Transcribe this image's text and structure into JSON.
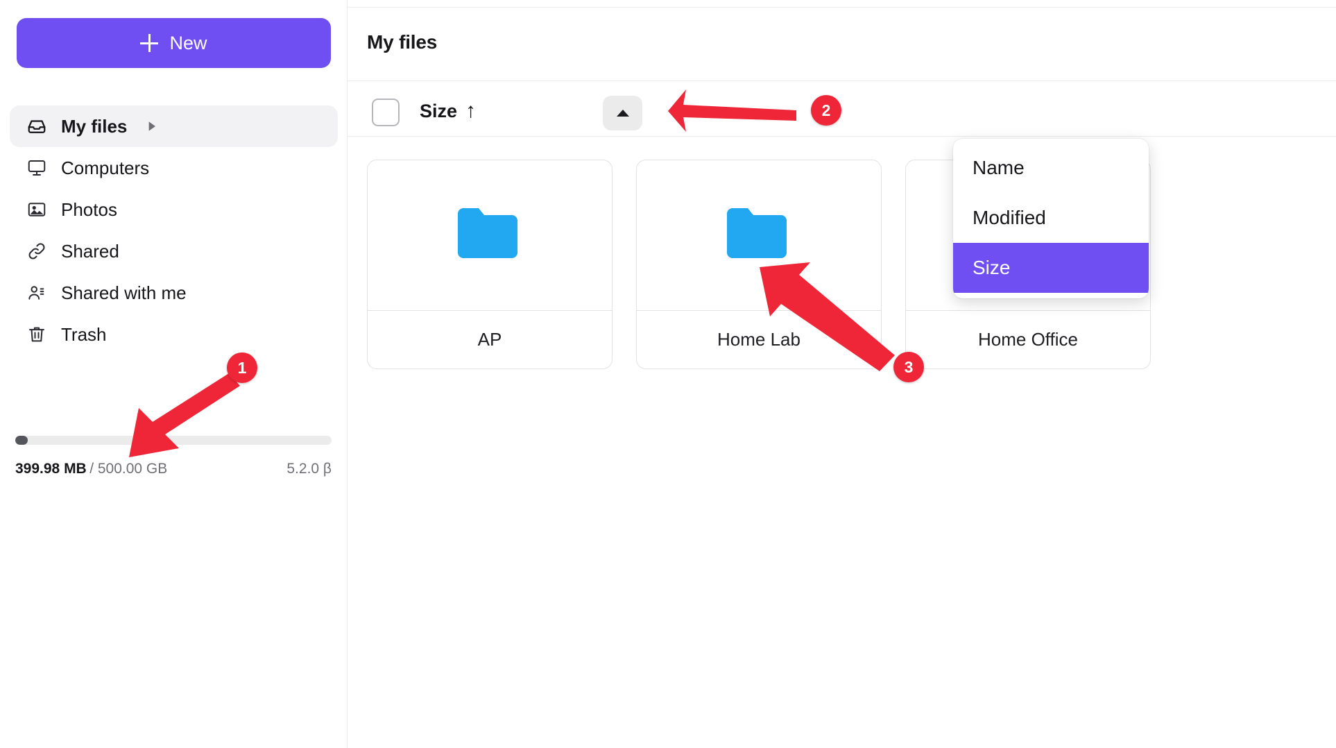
{
  "colors": {
    "accent_purple": "#6f4ef2",
    "folder_blue": "#22a8f0",
    "annotation_red": "#ee2637",
    "sidebar_active_bg": "#f2f2f4",
    "border": "#e2e2e5"
  },
  "sidebar": {
    "new_button": {
      "label": "New",
      "icon": "plus-icon"
    },
    "items": [
      {
        "label": "My files",
        "icon": "inbox-tray-icon",
        "active": true,
        "has_chevron": true
      },
      {
        "label": "Computers",
        "icon": "monitor-icon",
        "active": false,
        "has_chevron": false
      },
      {
        "label": "Photos",
        "icon": "image-icon",
        "active": false,
        "has_chevron": false
      },
      {
        "label": "Shared",
        "icon": "link-icon",
        "active": false,
        "has_chevron": false
      },
      {
        "label": "Shared with me",
        "icon": "users-icon",
        "active": false,
        "has_chevron": false
      },
      {
        "label": "Trash",
        "icon": "trash-icon",
        "active": false,
        "has_chevron": false
      }
    ],
    "storage": {
      "used": "399.98 MB",
      "separator_and_total": "/ 500.00 GB",
      "percent_filled": 4,
      "version": "5.2.0 β"
    }
  },
  "main": {
    "title": "My files",
    "toolbar": {
      "select_all_checked": false,
      "sort_field_label": "Size",
      "sort_direction_glyph": "↑",
      "sort_button_icon": "caret-up-icon"
    },
    "cards": [
      {
        "label": "AP",
        "icon": "folder-icon"
      },
      {
        "label": "Home Lab",
        "icon": "folder-icon"
      },
      {
        "label": "Home Office",
        "icon": "document-gradient-icon"
      }
    ]
  },
  "dropdown": {
    "open": true,
    "options": [
      {
        "label": "Name",
        "selected": false
      },
      {
        "label": "Modified",
        "selected": false
      },
      {
        "label": "Size",
        "selected": true
      }
    ]
  },
  "annotations": [
    {
      "number": "1",
      "target": "storage-bar"
    },
    {
      "number": "2",
      "target": "sort-direction-button"
    },
    {
      "number": "3",
      "target": "dropdown-option-size"
    }
  ]
}
